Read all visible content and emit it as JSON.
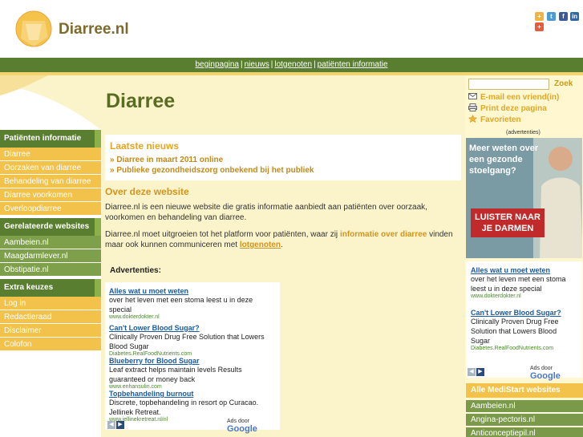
{
  "header": {
    "logo_text": "Diarree.nl",
    "social": [
      "more-icon",
      "twitter-icon",
      "facebook-icon",
      "linkedin-icon",
      "plus-icon"
    ]
  },
  "nav": {
    "items": [
      "beginpagina",
      "nieuws",
      "lotgenoten",
      "patiënten informatie"
    ],
    "separator": "|"
  },
  "page": {
    "title": "Diarree"
  },
  "tools": {
    "search_placeholder": "",
    "search_button": "Zoek",
    "email": "E-mail een vriend(in)",
    "print": "Print deze pagina",
    "favorites": "Favorieten"
  },
  "sidebar": {
    "patient_head": "Patiënten informatie",
    "patient_items": [
      "Diarree",
      "Oorzaken van diarree",
      "Behandeling van diarree",
      "Diarree voorkomen",
      "Overloopdiarree"
    ],
    "related_head": "Gerelateerde websites",
    "related_items": [
      "Aambeien.nl",
      "Maagdarmlever.nl",
      "Obstipatie.nl"
    ],
    "extra_head": "Extra keuzes",
    "extra_items": [
      "Log in",
      "Redactieraad",
      "Disclaimer",
      "Colofon"
    ]
  },
  "news": {
    "title": "Laatste nieuws",
    "items": [
      "» Diarree in maart 2011 online",
      "» Publieke gezondheidszorg onbekend bij het publiek"
    ]
  },
  "about": {
    "title": "Over deze website",
    "p1": "Diarree.nl is een nieuwe website die gratis informatie aanbiedt aan patiënten over oorzaak, voorkomen en behandeling van diarree.",
    "p2_pre": "Diarree.nl moet uitgroeien tot het platform voor patiënten, waar zij ",
    "p2_link1": "informatie over diarree",
    "p2_mid": " vinden maar ook kunnen communiceren met ",
    "p2_link2": "lotgenoten",
    "p2_end": "."
  },
  "ads_main": {
    "label": "Advertenties:",
    "items": [
      {
        "title": "Alles wat u moet weten",
        "text": "over het leven met een stoma leest u in deze special",
        "url": "www.dokterdokter.nl"
      },
      {
        "title": "Can't Lower Blood Sugar?",
        "text": "Clinically Proven Drug Free Solution that Lowers Blood Sugar",
        "url": "Diabetes.RealFoodNutrients.com"
      },
      {
        "title": "Blueberry for Blood Sugar",
        "text": "Leaf extract helps maintain levels Results guaranteed or money back",
        "url": "www.enhansulin.com"
      },
      {
        "title": "Topbehandeling burnout",
        "text": "Discrete, topbehandeling in resort op Curacao. Jellinek Retreat.",
        "url": "www.jellinekretreat.nl/nl"
      }
    ],
    "footer": "Ads door",
    "google": "Google"
  },
  "banner": {
    "label": "(advertenties)",
    "head": "Meer weten over een gezonde stoelgang?",
    "cta_line1": "LUISTER NAAR",
    "cta_line2": "JE DARMEN"
  },
  "ads_right": {
    "items": [
      {
        "title": "Alles wat u moet weten",
        "text": "over het leven met een stoma leest u in deze special",
        "url": "www.dokterdokter.nl"
      },
      {
        "title": "Can't Lower Blood Sugar?",
        "text": "Clinically Proven Drug Free Solution that Lowers Blood Sugar",
        "url": "Diabetes.RealFoodNutrients.com"
      }
    ],
    "footer": "Ads door",
    "google": "Google"
  },
  "medistart": {
    "head": "Alle MediStart websites",
    "items": [
      "Aambeien.nl",
      "Angina-pectoris.nl",
      "Anticonceptiepil.nl"
    ]
  },
  "colors": {
    "green": "#5a7e2f",
    "yellow": "#f2c24a",
    "orange": "#e8a521",
    "cream": "#fbf3c9"
  }
}
